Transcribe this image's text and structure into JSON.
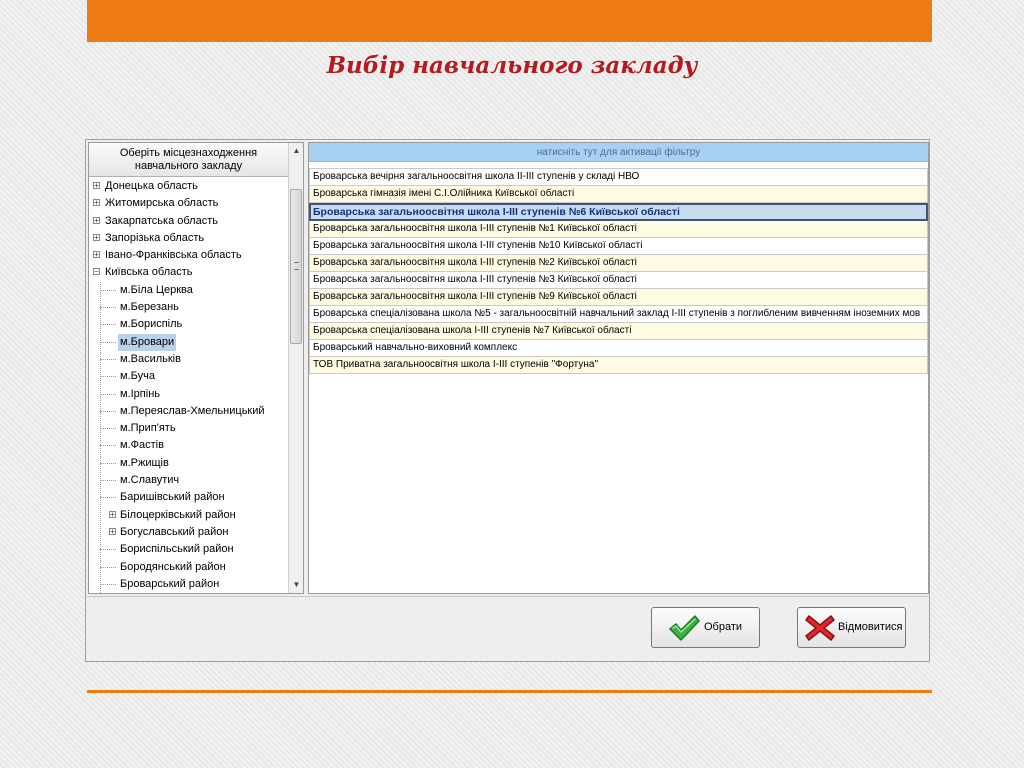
{
  "slide": {
    "title": "Вибір навчального закладу"
  },
  "tree": {
    "header": "Оберіть місцезнаходження навчального закладу",
    "items": [
      {
        "label": "Донецька область",
        "level": 0,
        "expander": "+"
      },
      {
        "label": "Житомирська область",
        "level": 0,
        "expander": "+"
      },
      {
        "label": "Закарпатська область",
        "level": 0,
        "expander": "+"
      },
      {
        "label": "Запорізька область",
        "level": 0,
        "expander": "+"
      },
      {
        "label": "Івано-Франківська область",
        "level": 0,
        "expander": "+"
      },
      {
        "label": "Київська область",
        "level": 0,
        "expander": "−"
      },
      {
        "label": "м.Біла Церква",
        "level": 1
      },
      {
        "label": "м.Березань",
        "level": 1
      },
      {
        "label": "м.Бориспіль",
        "level": 1
      },
      {
        "label": "м.Бровари",
        "level": 1,
        "selected": true
      },
      {
        "label": "м.Васильків",
        "level": 1
      },
      {
        "label": "м.Буча",
        "level": 1
      },
      {
        "label": "м.Ірпінь",
        "level": 1
      },
      {
        "label": "м.Переяслав-Хмельницький",
        "level": 1
      },
      {
        "label": "м.Прип'ять",
        "level": 1
      },
      {
        "label": "м.Фастів",
        "level": 1
      },
      {
        "label": "м.Ржищів",
        "level": 1
      },
      {
        "label": "м.Славутич",
        "level": 1
      },
      {
        "label": "Баришівський район",
        "level": 1
      },
      {
        "label": "Білоцерківський район",
        "level": 1,
        "expander": "+"
      },
      {
        "label": "Богуславський район",
        "level": 1,
        "expander": "+"
      },
      {
        "label": "Бориспільський район",
        "level": 1
      },
      {
        "label": "Бородянський район",
        "level": 1
      },
      {
        "label": "Броварський район",
        "level": 1
      }
    ]
  },
  "list": {
    "filter_hint": "натисніть тут для активації фільтру",
    "schools": [
      {
        "name": "Броварська вечірня загальноосвітня школа II-III ступенів у складі НВО"
      },
      {
        "name": "Броварська гімназія імені С.І.Олійника Київської області"
      },
      {
        "name": "Броварська загальноосвітня школа І-ІІІ ступенів №6 Київської області",
        "selected": true
      },
      {
        "name": "Броварська загальноосвітня школа І-ІІІ ступенів №1 Київської області"
      },
      {
        "name": "Броварська загальноосвітня школа І-ІІІ ступенів №10 Київської області"
      },
      {
        "name": "Броварська загальноосвітня школа І-ІІІ ступенів №2 Київської області"
      },
      {
        "name": "Броварська загальноосвітня школа І-ІІІ ступенів №3 Київської області"
      },
      {
        "name": "Броварська загальноосвітня школа І-ІІІ ступенів №9 Київської області"
      },
      {
        "name": "Броварська спеціалізована школа №5 - загальноосвітній навчальний заклад І-ІІІ ступенів з поглибленим вивченням іноземних мов"
      },
      {
        "name": "Броварська спеціалізована школа І-ІІІ ступенів №7 Київської області"
      },
      {
        "name": "Броварський навчально-виховний комплекс"
      },
      {
        "name": "ТОВ Приватна загальноосвітня школа І-ІІІ ступенів \"Фортуна\""
      }
    ]
  },
  "buttons": {
    "ok_label": "Обрати",
    "cancel_label": "Відмовитися"
  },
  "icons": {
    "ok": "checkmark-icon",
    "cancel": "cross-icon",
    "scroll_up": "arrow-up-icon",
    "scroll_down": "arrow-down-icon"
  },
  "colors": {
    "accent": "#ee7c12",
    "title": "#b51a1e",
    "filter_bar": "#a8d0f3",
    "selection": "#b9d1ea",
    "row_alt": "#fffbe3"
  }
}
